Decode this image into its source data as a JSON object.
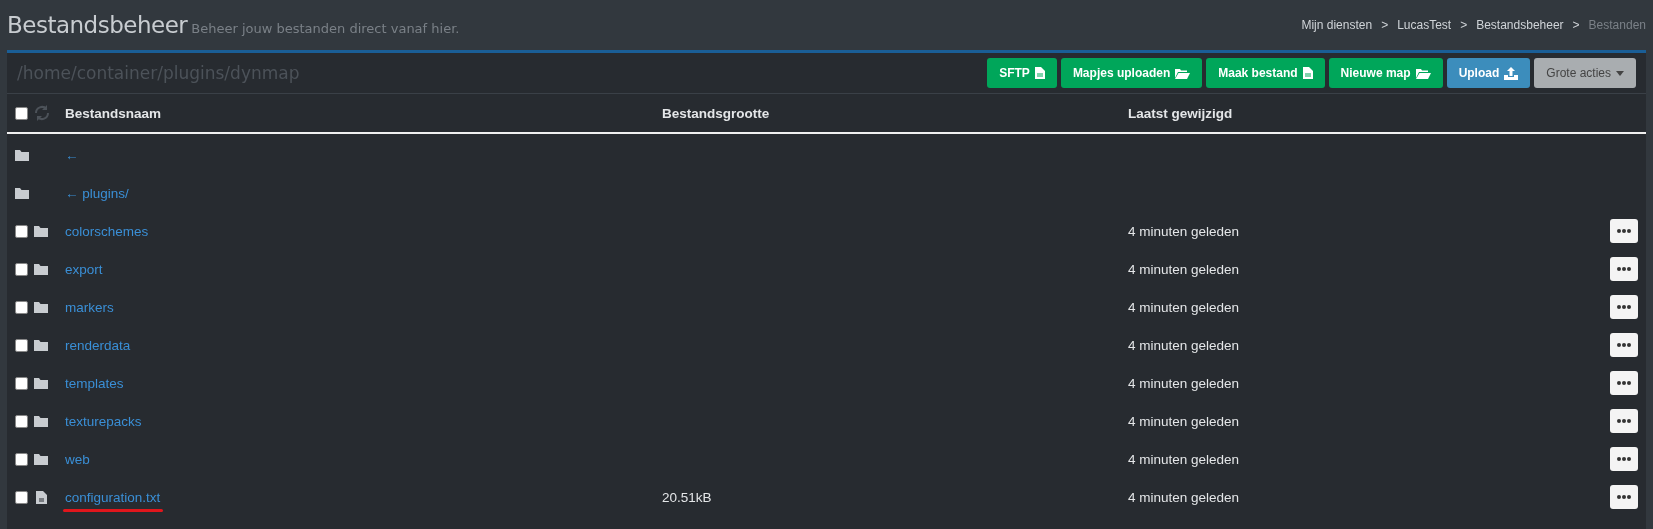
{
  "header": {
    "title": "Bestandsbeheer",
    "subtitle": "Beheer jouw bestanden direct vanaf hier.",
    "breadcrumb": [
      {
        "label": "Mijn diensten",
        "current": false
      },
      {
        "label": "LucasTest",
        "current": false
      },
      {
        "label": "Bestandsbeheer",
        "current": false
      },
      {
        "label": "Bestanden",
        "current": true
      }
    ],
    "separator": ">"
  },
  "path": "/home/container/plugins/dynmap",
  "actions": [
    {
      "label": "SFTP",
      "kind": "green"
    },
    {
      "label": "Mapjes uploaden",
      "kind": "green"
    },
    {
      "label": "Maak bestand",
      "kind": "green"
    },
    {
      "label": "Nieuwe map",
      "kind": "green"
    },
    {
      "label": "Upload",
      "kind": "blue"
    },
    {
      "label": "Grote acties",
      "kind": "grey"
    }
  ],
  "table": {
    "columns": [
      "Bestandsnaam",
      "Bestandsgrootte",
      "Laatst gewijzigd"
    ],
    "select_all_checked": false,
    "rows": [
      {
        "kind": "parent",
        "name": "←"
      },
      {
        "kind": "parent",
        "name": "← plugins/"
      },
      {
        "kind": "folder",
        "name": "colorschemes",
        "modified": "4 minuten geleden",
        "checked": false
      },
      {
        "kind": "folder",
        "name": "export",
        "modified": "4 minuten geleden",
        "checked": false
      },
      {
        "kind": "folder",
        "name": "markers",
        "modified": "4 minuten geleden",
        "checked": false
      },
      {
        "kind": "folder",
        "name": "renderdata",
        "modified": "4 minuten geleden",
        "checked": false
      },
      {
        "kind": "folder",
        "name": "templates",
        "modified": "4 minuten geleden",
        "checked": false
      },
      {
        "kind": "folder",
        "name": "texturepacks",
        "modified": "4 minuten geleden",
        "checked": false
      },
      {
        "kind": "folder",
        "name": "web",
        "modified": "4 minuten geleden",
        "checked": false
      },
      {
        "kind": "file",
        "name": "configuration.txt",
        "size": "20.51kB",
        "modified": "4 minuten geleden",
        "checked": false,
        "underlined": true
      }
    ]
  }
}
